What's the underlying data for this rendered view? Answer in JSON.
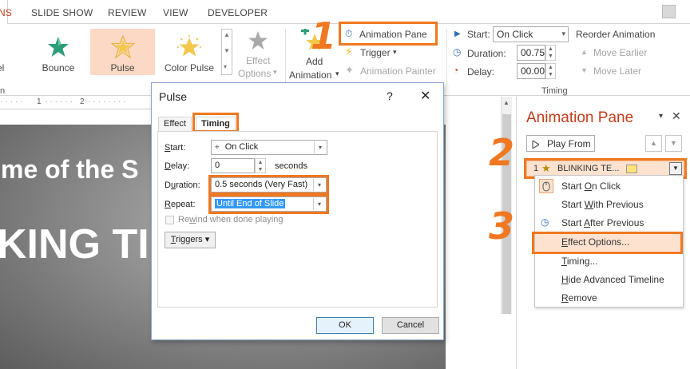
{
  "ribbon_tabs": [
    {
      "label": "NS",
      "active": true
    },
    {
      "label": "SLIDE SHOW"
    },
    {
      "label": "REVIEW"
    },
    {
      "label": "VIEW"
    },
    {
      "label": "DEVELOPER"
    }
  ],
  "effects_gallery": {
    "items": [
      {
        "label": "el",
        "icon": "star-icon-partial"
      },
      {
        "label": "Bounce",
        "icon": "star-bounce-icon"
      },
      {
        "label": "Pulse",
        "icon": "star-pulse-icon",
        "selected": true
      },
      {
        "label": "Color Pulse",
        "icon": "star-color-pulse-icon"
      }
    ],
    "effect_options_label_1": "Effect",
    "effect_options_label_2": "Options",
    "effect_options_arrow": "▾",
    "group_label": "n"
  },
  "advanced_animation": {
    "add_animation_1": "Add",
    "add_animation_2": "Animation",
    "add_animation_arrow": "▾",
    "animation_pane": "Animation Pane",
    "trigger": "Trigger",
    "trigger_arrow": "▾",
    "animation_painter": "Animation Painter"
  },
  "timing_group": {
    "start_label": "Start:",
    "start_value": "On Click",
    "duration_label": "Duration:",
    "duration_value": "00.75",
    "delay_label": "Delay:",
    "delay_value": "00.00",
    "reorder_label": "Reorder Animation",
    "move_earlier": "Move Earlier",
    "move_later": "Move Later",
    "group_label": "Timing"
  },
  "ruler": {
    "ticks": [
      "1",
      "2"
    ]
  },
  "slide": {
    "title_line_1": "me of the S",
    "title_line_2": "KING TI"
  },
  "dialog": {
    "title": "Pulse",
    "help": "?",
    "close": "✕",
    "tabs": [
      {
        "label": "Effect"
      },
      {
        "label": "Timing",
        "active": true
      }
    ],
    "start_label_u": "S",
    "start_label_rest": "tart:",
    "start_value": "On Click",
    "delay_label_u": "D",
    "delay_label_rest": "elay:",
    "delay_value": "0",
    "delay_unit": "seconds",
    "duration_label_pre": "D",
    "duration_label_u": "u",
    "duration_label_rest": "ration:",
    "duration_value": "0.5 seconds (Very Fast)",
    "repeat_label_u": "R",
    "repeat_label_rest": "epeat:",
    "repeat_value": "Until End of Slide",
    "rewind_pre": "Re",
    "rewind_u": "w",
    "rewind_rest": "ind when done playing",
    "triggers_u": "T",
    "triggers_rest": "riggers",
    "triggers_arrow": "▾",
    "ok": "OK",
    "cancel": "Cancel"
  },
  "animation_pane": {
    "title": "Animation Pane",
    "options_arrow": "▾",
    "close": "✕",
    "play_from": "Play From",
    "move_up": "▲",
    "move_down": "▼",
    "item": {
      "number": "1",
      "name": "BLINKING TE...",
      "dropdown": "▼"
    },
    "context_menu": [
      {
        "label_pre": "Start ",
        "label_u": "O",
        "label_rest": "n Click",
        "icon": "mouse-click-icon",
        "checked": true
      },
      {
        "label_pre": "Start ",
        "label_u": "W",
        "label_rest": "ith Previous"
      },
      {
        "label_pre": "Start ",
        "label_u": "A",
        "label_rest": "fter Previous",
        "icon": "clock-icon"
      },
      {
        "label_pre": "",
        "label_u": "E",
        "label_rest": "ffect Options...",
        "highlighted": true
      },
      {
        "label_pre": "",
        "label_u": "T",
        "label_rest": "iming..."
      },
      {
        "label_pre": "",
        "label_u": "H",
        "label_rest": "ide Advanced Timeline"
      },
      {
        "label_pre": "",
        "label_u": "R",
        "label_rest": "emove"
      }
    ]
  },
  "step_labels": [
    "1",
    "2",
    "3"
  ],
  "colors": {
    "accent_orange": "#f07820",
    "office_red": "#c43e1c",
    "selection_peach": "#fcd9c4",
    "highlight_blue": "#3399ff"
  }
}
